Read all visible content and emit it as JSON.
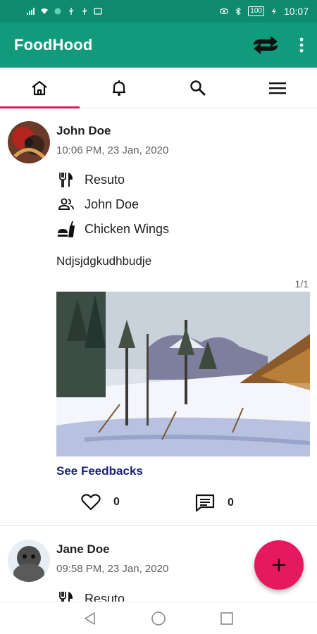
{
  "status_bar": {
    "battery": "100",
    "time": "10:07"
  },
  "app_bar": {
    "title": "FoodHood",
    "icons": [
      "swap-icon",
      "more-vert-icon"
    ]
  },
  "tabs": [
    {
      "icon": "home-icon",
      "active": true
    },
    {
      "icon": "bell-icon",
      "active": false
    },
    {
      "icon": "search-icon",
      "active": false
    },
    {
      "icon": "menu-icon",
      "active": false
    }
  ],
  "posts": [
    {
      "author": "John Doe",
      "timestamp": "10:06 PM, 23 Jan, 2020",
      "restaurant": "Resuto",
      "person": "John Doe",
      "dish": "Chicken Wings",
      "description": "Ndjsjdgkudhbudje",
      "image_counter": "1/1",
      "see_feedbacks": "See Feedbacks",
      "likes": "0",
      "comments": "0"
    },
    {
      "author": "Jane Doe",
      "timestamp": "09:58 PM, 23 Jan, 2020",
      "restaurant": "Resuto"
    }
  ],
  "colors": {
    "status_bar": "#0e8a6e",
    "app_bar": "#129a7c",
    "tab_indicator": "#d81b60",
    "fab": "#e5195d",
    "link": "#1a237e"
  }
}
